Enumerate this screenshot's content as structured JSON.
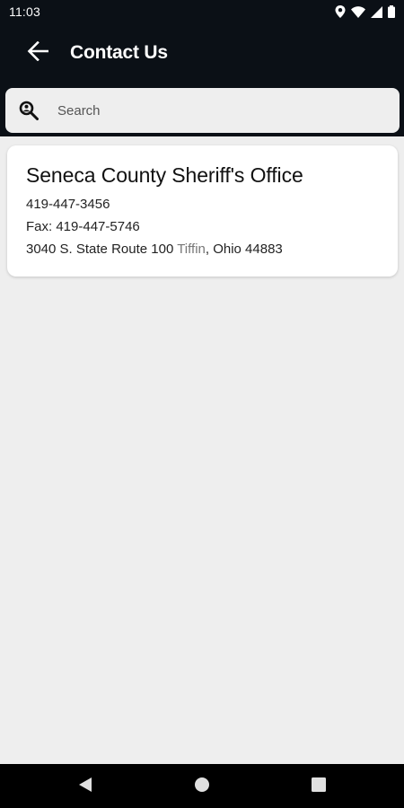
{
  "status_bar": {
    "time": "11:03",
    "icons": [
      "location-icon",
      "wifi-icon",
      "signal-icon",
      "battery-icon"
    ]
  },
  "app_bar": {
    "title": "Contact Us",
    "back_icon": "arrow-left-icon"
  },
  "search": {
    "placeholder": "Search",
    "value": "",
    "icon": "search-person-icon"
  },
  "contact": {
    "name": "Seneca County Sheriff's Office",
    "phone": "419-447-3456",
    "fax": "Fax: 419-447-5746",
    "address_part1": "3040 S. State Route 100 ",
    "address_city": "Tiffin",
    "address_part2": ", Ohio 44883"
  },
  "nav_bar": {
    "buttons": [
      "back-triangle-icon",
      "home-circle-icon",
      "recents-square-icon"
    ]
  },
  "colors": {
    "header_bg": "#0b1016",
    "page_bg": "#eeeeee",
    "card_bg": "#ffffff",
    "nav_bg": "#000000"
  }
}
